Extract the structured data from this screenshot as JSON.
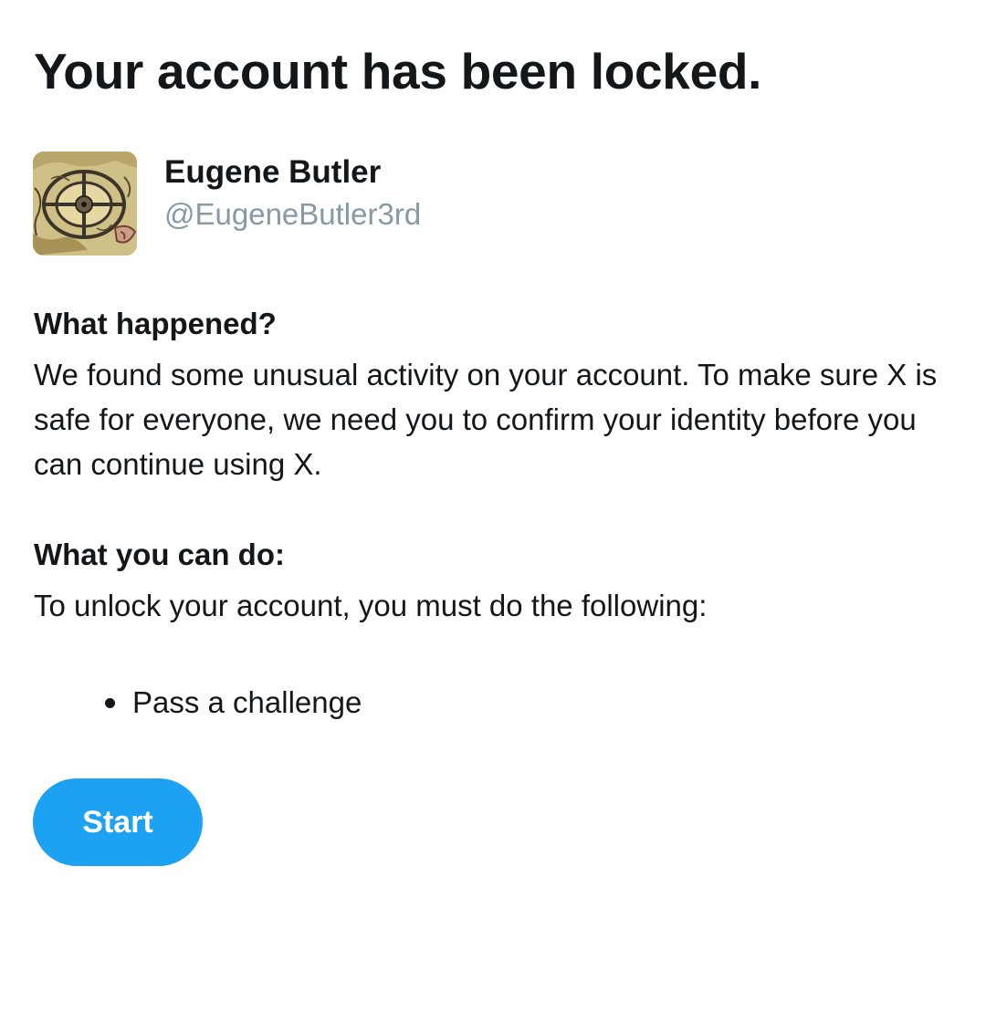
{
  "page": {
    "title": "Your account has been locked."
  },
  "profile": {
    "display_name": "Eugene Butler",
    "handle": "@EugeneButler3rd",
    "avatar_icon": "map-artwork-avatar"
  },
  "what_happened": {
    "heading": "What happened?",
    "body": "We found some unusual activity on your account. To make sure X is safe for everyone, we need you to confirm your identity before you can continue using X."
  },
  "what_you_can_do": {
    "heading": "What you can do:",
    "body": "To unlock your account, you must do the following:",
    "steps": [
      "Pass a challenge"
    ]
  },
  "actions": {
    "start_label": "Start"
  },
  "colors": {
    "text": "#14171a",
    "muted": "#8899a6",
    "accent": "#1da1f2",
    "background": "#ffffff"
  }
}
